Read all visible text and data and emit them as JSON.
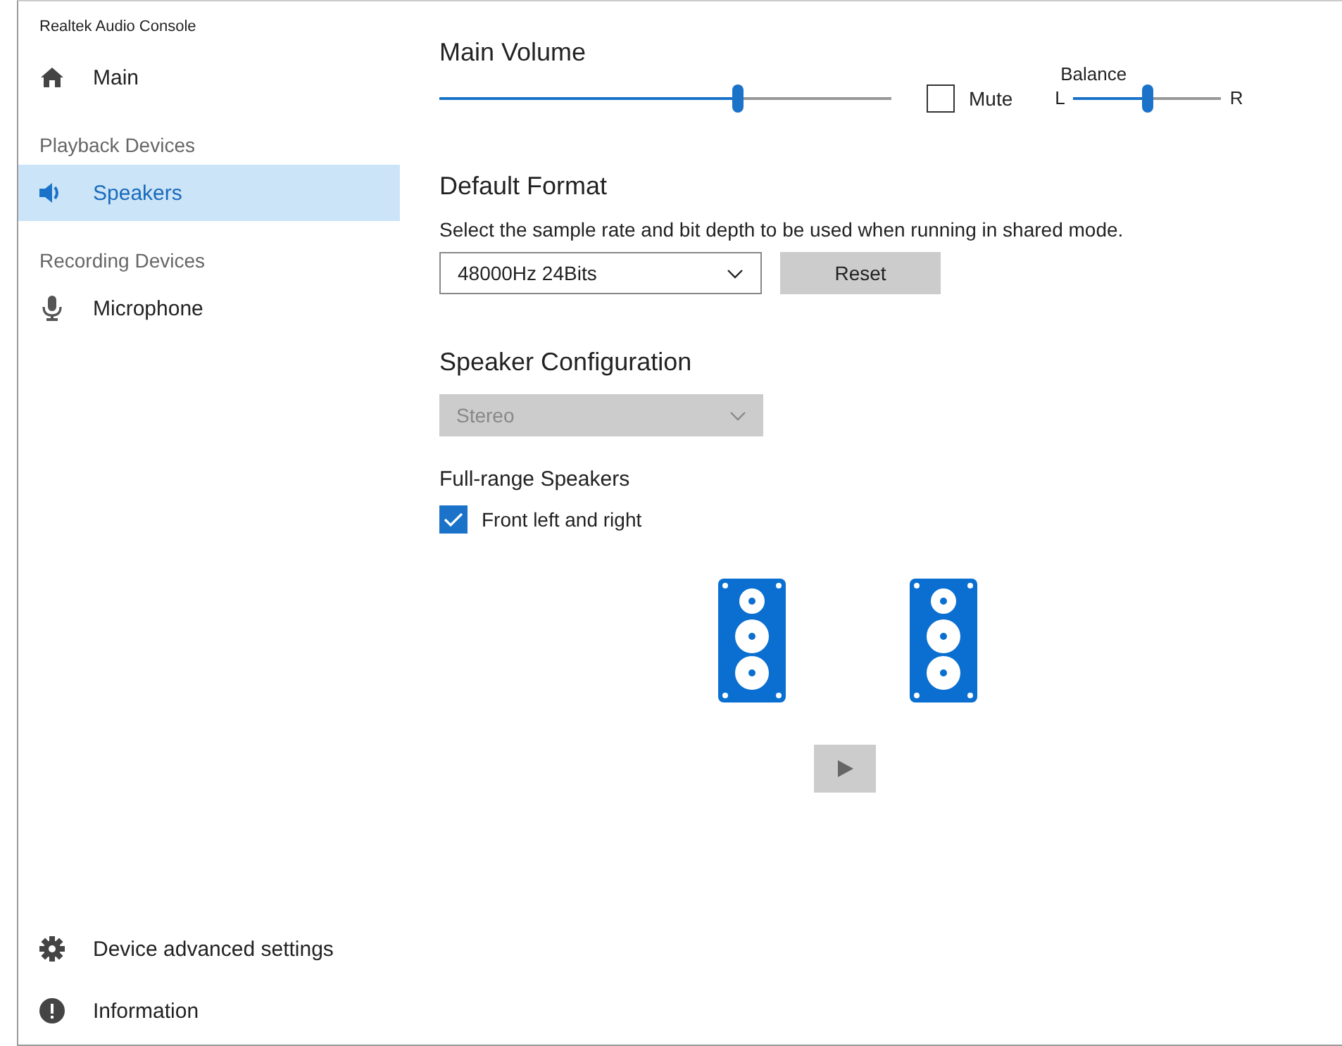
{
  "window": {
    "title": "Realtek Audio Console"
  },
  "sidebar": {
    "top": [
      {
        "label": "Main",
        "selected": false
      }
    ],
    "groups": [
      {
        "heading": "Playback Devices",
        "items": [
          {
            "label": "Speakers",
            "selected": true
          }
        ]
      },
      {
        "heading": "Recording Devices",
        "items": [
          {
            "label": "Microphone",
            "selected": false
          }
        ]
      }
    ],
    "bottom": [
      {
        "label": "Device advanced settings"
      },
      {
        "label": "Information"
      }
    ]
  },
  "main_volume": {
    "title": "Main Volume",
    "level": 0.66,
    "mute": {
      "label": "Mute",
      "checked": false
    },
    "balance": {
      "label": "Balance",
      "left": "L",
      "right": "R",
      "level": 0.5
    }
  },
  "default_format": {
    "title": "Default Format",
    "description": "Select the sample rate and bit depth to be used when running in shared mode.",
    "format_dropdown": {
      "value": "48000Hz 24Bits"
    },
    "reset_button": "Reset"
  },
  "speaker_configuration": {
    "title": "Speaker Configuration",
    "dropdown": {
      "value": "Stereo",
      "disabled": true
    },
    "full_range": {
      "title": "Full-range Speakers",
      "checkbox": {
        "label": "Front left and right",
        "checked": true
      }
    },
    "play_button": {
      "disabled": true
    }
  }
}
